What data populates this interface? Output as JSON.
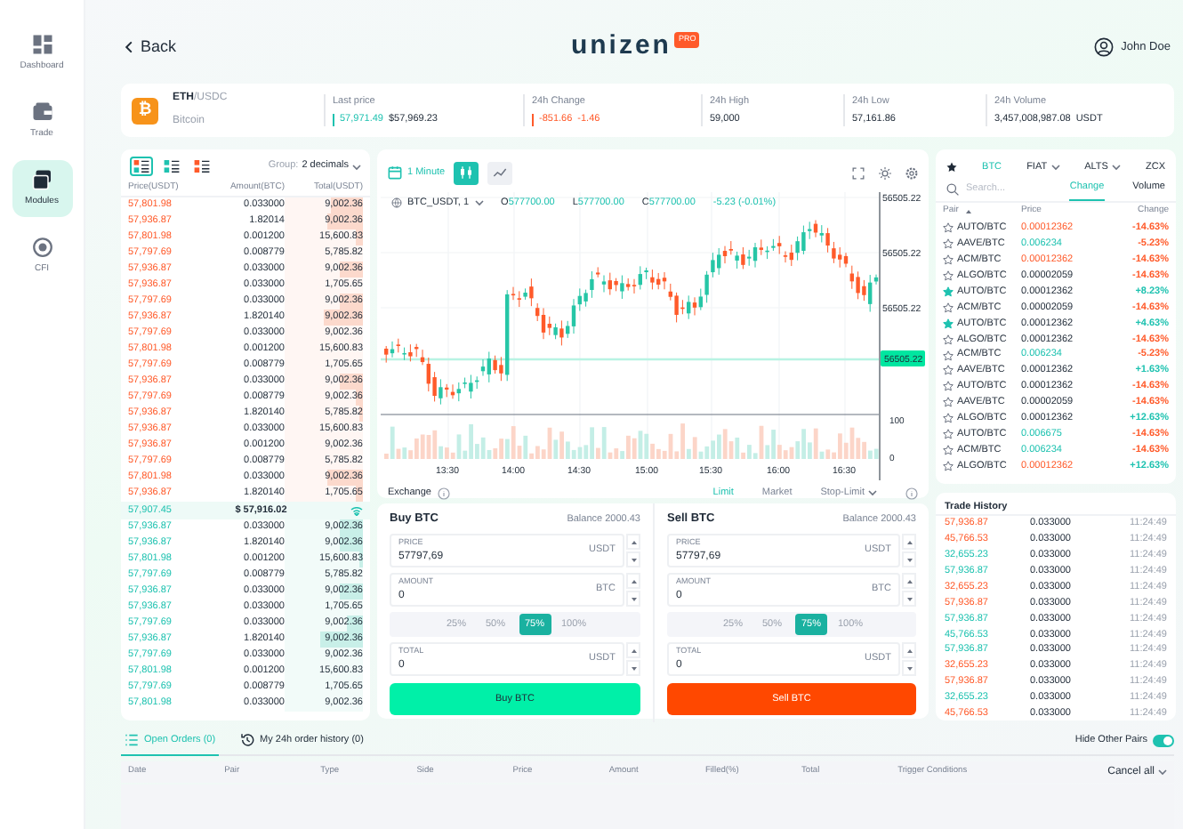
{
  "sidebar": {
    "items": [
      {
        "kind": "dashboard",
        "label": "Dashboard",
        "selected": false
      },
      {
        "kind": "trade",
        "label": "Trade",
        "selected": false
      },
      {
        "kind": "modules",
        "label": "Modules",
        "selected": true
      },
      {
        "kind": "cfi",
        "label": "CFI",
        "selected": false
      }
    ]
  },
  "header": {
    "back": "Back",
    "logo": "unizen",
    "badge": "PRO",
    "user": "John Doe"
  },
  "ticker": {
    "coin_symbol": "₿",
    "base": "ETH",
    "quote": "/USDC",
    "name": "Bitcoin",
    "stats": [
      {
        "kind": "up",
        "label": "Last price",
        "value": "57,971.49",
        "secondary": "$57,969.23"
      },
      {
        "kind": "down",
        "label": "24h Change",
        "value": "-851.66",
        "secondary": "-1.46"
      },
      {
        "kind": "plain",
        "label": "24h High",
        "value": "59,000"
      },
      {
        "kind": "plain",
        "label": "24h Low",
        "value": "57,161.86"
      },
      {
        "kind": "plain",
        "label": "24h Volume",
        "value": "3,457,008,987.08",
        "unit": "USDT"
      }
    ]
  },
  "order_book": {
    "views": [
      {
        "kind": "both",
        "selected": true
      },
      {
        "kind": "bids",
        "selected": false
      },
      {
        "kind": "asks",
        "selected": false
      }
    ],
    "group_label": "Group:",
    "group_value": "2 decimals",
    "columns": [
      "Price(USDT)",
      "Amount(BTC)",
      "Total(USDT)"
    ],
    "asks": [
      {
        "price": "57,801.98",
        "amount": "0.033000",
        "total": "9,002.36",
        "level": 0.4
      },
      {
        "price": "57,936.87",
        "amount": "1.82014",
        "total": "9,002.36",
        "level": 0.45
      },
      {
        "price": "57,801.98",
        "amount": "0.001200",
        "total": "15,600.83",
        "level": 0.1
      },
      {
        "price": "57,797.69",
        "amount": "0.008779",
        "total": "5,785.82",
        "level": 0
      },
      {
        "price": "57,936.87",
        "amount": "0.033000",
        "total": "9,002.36",
        "level": 0.3
      },
      {
        "price": "57,936.87",
        "amount": "0.033000",
        "total": "1,705.65",
        "level": 0
      },
      {
        "price": "57,797.69",
        "amount": "0.033000",
        "total": "9,002.36",
        "level": 0.3
      },
      {
        "price": "57,936.87",
        "amount": "1.820140",
        "total": "9,002.36",
        "level": 0.5
      },
      {
        "price": "57,797.69",
        "amount": "0.033000",
        "total": "9,002.36",
        "level": 0
      },
      {
        "price": "57,801.98",
        "amount": "0.001200",
        "total": "15,600.83",
        "level": 0
      },
      {
        "price": "57,797.69",
        "amount": "0.008779",
        "total": "1,705.65",
        "level": 0
      },
      {
        "price": "57,936.87",
        "amount": "0.033000",
        "total": "9,002.36",
        "level": 0.3
      },
      {
        "price": "57,797.69",
        "amount": "0.008779",
        "total": "9,002.36",
        "level": 0.1
      },
      {
        "price": "57,936.87",
        "amount": "1.820140",
        "total": "5,785.82",
        "level": 0.05
      },
      {
        "price": "57,936.87",
        "amount": "0.033000",
        "total": "15,600.83",
        "level": 0
      },
      {
        "price": "57,936.87",
        "amount": "0.001200",
        "total": "9,002.36",
        "level": 0
      },
      {
        "price": "57,797.69",
        "amount": "0.008779",
        "total": "5,785.82",
        "level": 0
      },
      {
        "price": "57,801.98",
        "amount": "0.033000",
        "total": "9,002.36",
        "level": 0.45
      },
      {
        "price": "57,936.87",
        "amount": "1.820140",
        "total": "1,705.65",
        "level": 0.1
      }
    ],
    "mid": {
      "price": "57,907.45",
      "usd": "$ 57,916.02"
    },
    "bids": [
      {
        "price": "57,936.87",
        "amount": "0.033000",
        "total": "9,002.36",
        "level": 0.3
      },
      {
        "price": "57,936.87",
        "amount": "1.820140",
        "total": "9,002.36",
        "level": 0.3
      },
      {
        "price": "57,801.98",
        "amount": "0.001200",
        "total": "15,600.83",
        "level": 0.05
      },
      {
        "price": "57,797.69",
        "amount": "0.008779",
        "total": "5,785.82",
        "level": 0
      },
      {
        "price": "57,936.87",
        "amount": "0.033000",
        "total": "9,002.36",
        "level": 0.3
      },
      {
        "price": "57,936.87",
        "amount": "0.033000",
        "total": "1,705.65",
        "level": 0
      },
      {
        "price": "57,797.69",
        "amount": "0.033000",
        "total": "9,002.36",
        "level": 0.2
      },
      {
        "price": "57,936.87",
        "amount": "1.820140",
        "total": "9,002.36",
        "level": 0.55
      },
      {
        "price": "57,797.69",
        "amount": "0.033000",
        "total": "9,002.36",
        "level": 0
      },
      {
        "price": "57,801.98",
        "amount": "0.001200",
        "total": "15,600.83",
        "level": 0
      },
      {
        "price": "57,797.69",
        "amount": "0.008779",
        "total": "1,705.65",
        "level": 0
      },
      {
        "price": "57,801.98",
        "amount": "0.033000",
        "total": "9,002.36",
        "level": 0
      }
    ]
  },
  "chart": {
    "interval": "1 Minute",
    "chart_types": [
      {
        "kind": "candles",
        "selected": true
      },
      {
        "kind": "line",
        "selected": false
      }
    ],
    "symbol": "BTC_USDT, 1",
    "ohlc": [
      {
        "key": "O",
        "value": "577700.00"
      },
      {
        "key": "L",
        "value": "577700.00"
      },
      {
        "key": "C",
        "value": "577700.00"
      }
    ],
    "change": "-5.23 (-0.01%)",
    "price_labels": [
      "56505.22",
      "56505.22",
      "56505.22"
    ],
    "current_price": "56505.22",
    "volume_labels": [
      "100",
      "0"
    ],
    "time_labels": [
      "13:30",
      "14:00",
      "14:30",
      "15:00",
      "15:30",
      "16:00",
      "16:30"
    ]
  },
  "order_panel": {
    "title": "Exchange",
    "order_types": [
      {
        "label": "Limit",
        "kind": "plain",
        "selected": true
      },
      {
        "label": "Market",
        "kind": "plain",
        "selected": false
      },
      {
        "label": "Stop-Limit",
        "kind": "menu",
        "selected": false
      }
    ],
    "forms": [
      {
        "kind": "buy",
        "title": "Buy BTC",
        "balance": "Balance 2000.43",
        "fields": [
          {
            "kind": "input",
            "label": "PRICE",
            "value": "57797,69",
            "unit": "USDT"
          },
          {
            "kind": "input",
            "label": "AMOUNT",
            "value": "0",
            "unit": "BTC"
          },
          {
            "kind": "percents",
            "options": [
              {
                "label": "25%",
                "selected": false
              },
              {
                "label": "50%",
                "selected": false
              },
              {
                "label": "75%",
                "selected": true
              },
              {
                "label": "100%",
                "selected": false
              }
            ]
          },
          {
            "kind": "input",
            "label": "TOTAL",
            "value": "0",
            "unit": "USDT"
          }
        ],
        "button": "Buy BTC"
      },
      {
        "kind": "sell",
        "title": "Sell BTC",
        "balance": "Balance 2000.43",
        "fields": [
          {
            "kind": "input",
            "label": "PRICE",
            "value": "57797,69",
            "unit": "USDT"
          },
          {
            "kind": "input",
            "label": "AMOUNT",
            "value": "0",
            "unit": "BTC"
          },
          {
            "kind": "percents",
            "options": [
              {
                "label": "25%",
                "selected": false
              },
              {
                "label": "50%",
                "selected": false
              },
              {
                "label": "75%",
                "selected": true
              },
              {
                "label": "100%",
                "selected": false
              }
            ]
          },
          {
            "kind": "input",
            "label": "TOTAL",
            "value": "0",
            "unit": "USDT"
          }
        ],
        "button": "Sell BTC"
      }
    ]
  },
  "markets": {
    "tabs": [
      {
        "kind": "star",
        "selected": false
      },
      {
        "kind": "plain",
        "label": "BTC",
        "selected": true
      },
      {
        "kind": "menu",
        "label": "FIAT",
        "selected": false
      },
      {
        "kind": "menu",
        "label": "ALTS",
        "selected": false
      },
      {
        "kind": "plain",
        "label": "ZCX",
        "selected": false
      }
    ],
    "search_placeholder": "Search...",
    "sort_tabs": [
      {
        "label": "Change",
        "selected": true
      },
      {
        "label": "Volume",
        "selected": false
      }
    ],
    "columns": [
      "Pair",
      "Price",
      "Change"
    ],
    "rows": [
      {
        "favorite": false,
        "pair": "AUTO/BTC",
        "price": {
          "text": "0.00012362",
          "color": "#ff5a2a"
        },
        "change": {
          "text": "-14.63%",
          "color": "#ff5a2a"
        }
      },
      {
        "favorite": false,
        "pair": "AAVE/BTC",
        "price": {
          "text": "0.006234",
          "color": "#1ec2b0"
        },
        "change": {
          "text": "-5.23%",
          "color": "#ff5a2a"
        }
      },
      {
        "favorite": false,
        "pair": "ACM/BTC",
        "price": {
          "text": "0.00012362",
          "color": "#ff5a2a"
        },
        "change": {
          "text": "-14.63%",
          "color": "#ff5a2a"
        }
      },
      {
        "favorite": false,
        "pair": "ALGO/BTC",
        "price": {
          "text": "0.00002059",
          "color": "#1f2a37"
        },
        "change": {
          "text": "-14.63%",
          "color": "#ff5a2a"
        }
      },
      {
        "favorite": true,
        "pair": "AUTO/BTC",
        "price": {
          "text": "0.00012362",
          "color": "#1f2a37"
        },
        "change": {
          "text": "+8.23%",
          "color": "#1ec2b0"
        }
      },
      {
        "favorite": false,
        "pair": "ACM/BTC",
        "price": {
          "text": "0.00002059",
          "color": "#1f2a37"
        },
        "change": {
          "text": "-14.63%",
          "color": "#ff5a2a"
        }
      },
      {
        "favorite": true,
        "pair": "AUTO/BTC",
        "price": {
          "text": "0.00012362",
          "color": "#1f2a37"
        },
        "change": {
          "text": "+4.63%",
          "color": "#1ec2b0"
        }
      },
      {
        "favorite": false,
        "pair": "ALGO/BTC",
        "price": {
          "text": "0.00012362",
          "color": "#1f2a37"
        },
        "change": {
          "text": "-14.63%",
          "color": "#ff5a2a"
        }
      },
      {
        "favorite": false,
        "pair": "ACM/BTC",
        "price": {
          "text": "0.006234",
          "color": "#1ec2b0"
        },
        "change": {
          "text": "-5.23%",
          "color": "#ff5a2a"
        }
      },
      {
        "favorite": false,
        "pair": "AAVE/BTC",
        "price": {
          "text": "0.00012362",
          "color": "#1f2a37"
        },
        "change": {
          "text": "+1.63%",
          "color": "#1ec2b0"
        }
      },
      {
        "favorite": false,
        "pair": "AUTO/BTC",
        "price": {
          "text": "0.00012362",
          "color": "#1f2a37"
        },
        "change": {
          "text": "-14.63%",
          "color": "#ff5a2a"
        }
      },
      {
        "favorite": false,
        "pair": "AAVE/BTC",
        "price": {
          "text": "0.00002059",
          "color": "#1f2a37"
        },
        "change": {
          "text": "-14.63%",
          "color": "#ff5a2a"
        }
      },
      {
        "favorite": false,
        "pair": "ALGO/BTC",
        "price": {
          "text": "0.00012362",
          "color": "#1f2a37"
        },
        "change": {
          "text": "+12.63%",
          "color": "#1ec2b0"
        }
      },
      {
        "favorite": false,
        "pair": "AUTO/BTC",
        "price": {
          "text": "0.006675",
          "color": "#1ec2b0"
        },
        "change": {
          "text": "-14.63%",
          "color": "#ff5a2a"
        }
      },
      {
        "favorite": false,
        "pair": "ACM/BTC",
        "price": {
          "text": "0.006234",
          "color": "#1ec2b0"
        },
        "change": {
          "text": "-14.63%",
          "color": "#ff5a2a"
        }
      },
      {
        "favorite": false,
        "pair": "ALGO/BTC",
        "price": {
          "text": "0.00012362",
          "color": "#ff5a2a"
        },
        "change": {
          "text": "+12.63%",
          "color": "#1ec2b0"
        }
      }
    ]
  },
  "trade_history": {
    "title": "Trade History",
    "rows": [
      {
        "price": "57,936.87",
        "color": "#ff5a2a",
        "amount": "0.033000",
        "time": "11:24:49"
      },
      {
        "price": "45,766.53",
        "color": "#ff5a2a",
        "amount": "0.033000",
        "time": "11:24:49"
      },
      {
        "price": "32,655.23",
        "color": "#1ec2b0",
        "amount": "0.033000",
        "time": "11:24:49"
      },
      {
        "price": "57,936.87",
        "color": "#1ec2b0",
        "amount": "0.033000",
        "time": "11:24:49"
      },
      {
        "price": "32,655.23",
        "color": "#ff5a2a",
        "amount": "0.033000",
        "time": "11:24:49"
      },
      {
        "price": "57,936.87",
        "color": "#ff5a2a",
        "amount": "0.033000",
        "time": "11:24:49"
      },
      {
        "price": "57,936.87",
        "color": "#1ec2b0",
        "amount": "0.033000",
        "time": "11:24:49"
      },
      {
        "price": "45,766.53",
        "color": "#1ec2b0",
        "amount": "0.033000",
        "time": "11:24:49"
      },
      {
        "price": "57,936.87",
        "color": "#1ec2b0",
        "amount": "0.033000",
        "time": "11:24:49"
      },
      {
        "price": "32,655.23",
        "color": "#ff5a2a",
        "amount": "0.033000",
        "time": "11:24:49"
      },
      {
        "price": "57,936.87",
        "color": "#ff5a2a",
        "amount": "0.033000",
        "time": "11:24:49"
      },
      {
        "price": "32,655.23",
        "color": "#1ec2b0",
        "amount": "0.033000",
        "time": "11:24:49"
      },
      {
        "price": "45,766.53",
        "color": "#ff5a2a",
        "amount": "0.033000",
        "time": "11:24:49"
      }
    ]
  },
  "orders": {
    "tabs": [
      {
        "kind": "list",
        "label": "Open Orders (0)",
        "selected": true
      },
      {
        "kind": "history",
        "label": "My 24h order history (0)",
        "selected": false
      }
    ],
    "hide_other_pairs": {
      "label": "Hide Other Pairs",
      "on": true
    },
    "columns": [
      "Date",
      "Pair",
      "Type",
      "Side",
      "Price",
      "Amount",
      "Filled(%)",
      "Total",
      "Trigger Conditions"
    ],
    "cancel_all": "Cancel all"
  }
}
